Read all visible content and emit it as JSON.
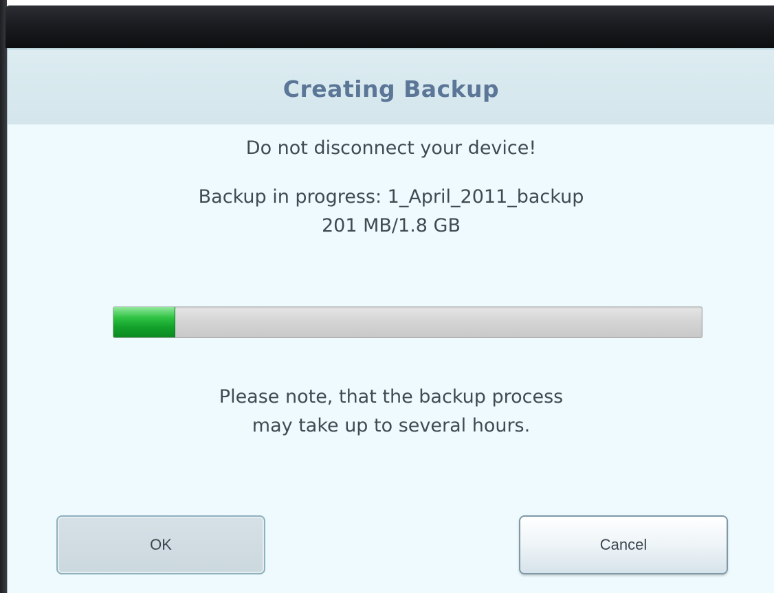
{
  "dialog": {
    "title": "Creating Backup",
    "warning": "Do not disconnect your device!",
    "progress_line1": "Backup in progress: 1_April_2011_backup",
    "progress_line2": "201 MB/1.8 GB",
    "progress_fraction": 0.104,
    "note_line1": "Please note, that the backup process",
    "note_line2": "may take up to several hours.",
    "ok_label": "OK",
    "cancel_label": "Cancel"
  },
  "colors": {
    "title_text": "#5b7697",
    "progress_fill": "#13a22b",
    "dialog_background": "#eefafd"
  }
}
